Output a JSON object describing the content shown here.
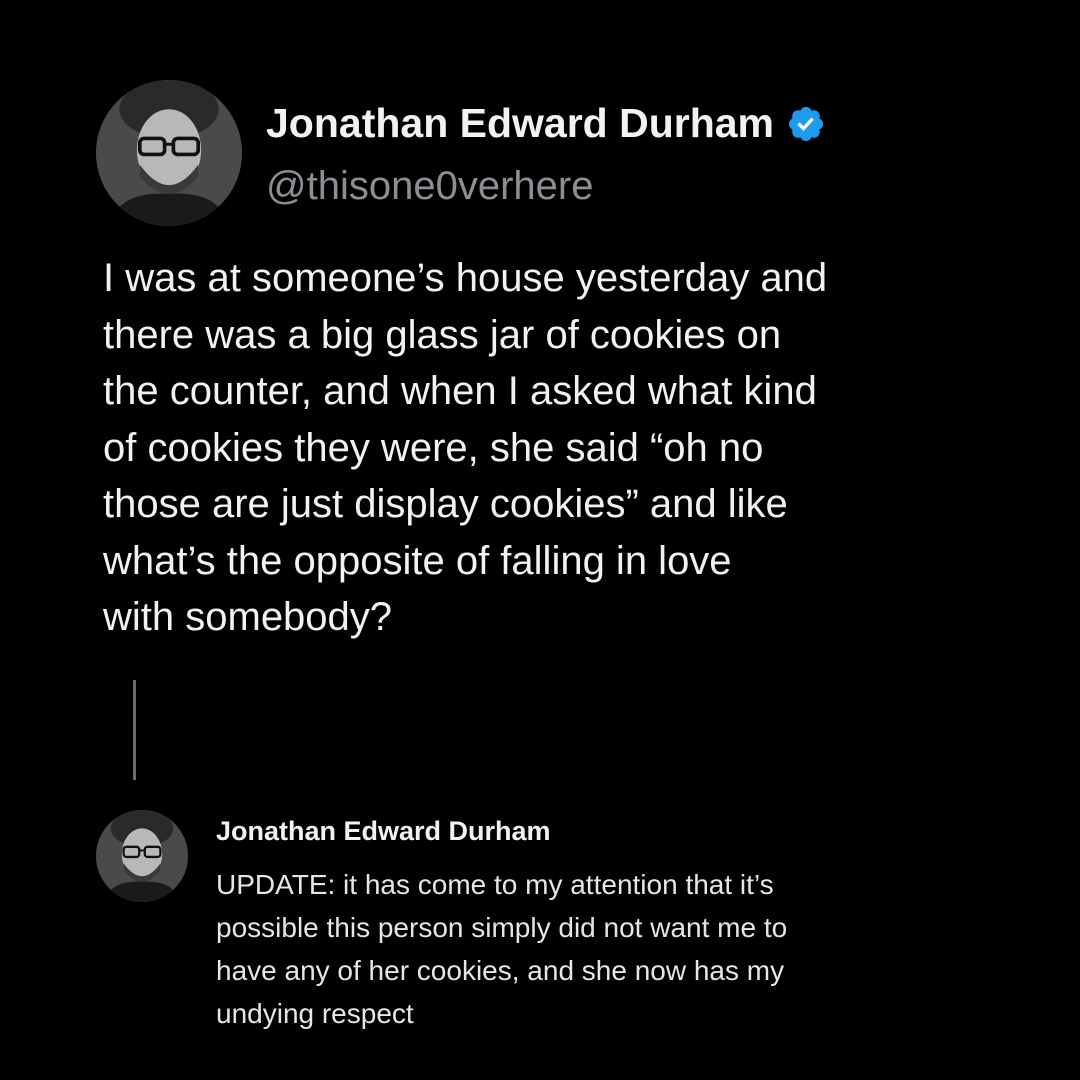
{
  "main_tweet": {
    "author": {
      "display_name": "Jonathan Edward Durham",
      "handle": "@thisone0verhere",
      "verified": true,
      "avatar_icon": "person-photo-avatar"
    },
    "text": "I was at someone’s house yesterday and\nthere was a big glass jar of cookies on\nthe counter, and when I asked what kind\nof cookies they were, she said “oh no\nthose are just display cookies” and like\nwhat’s the opposite of falling in love\nwith somebody?"
  },
  "reply_tweet": {
    "author": {
      "display_name": "Jonathan Edward Durham",
      "avatar_icon": "person-photo-avatar"
    },
    "text": "UPDATE: it has come to my attention that it’s\npossible this person simply did not want me to\nhave any of her cookies, and she now has my\nundying respect"
  },
  "colors": {
    "background": "#000000",
    "text_primary": "#f2f2f2",
    "text_secondary": "#8b8f94",
    "verified_badge": "#1d9bf0",
    "thread_line": "#6a6a6a"
  }
}
